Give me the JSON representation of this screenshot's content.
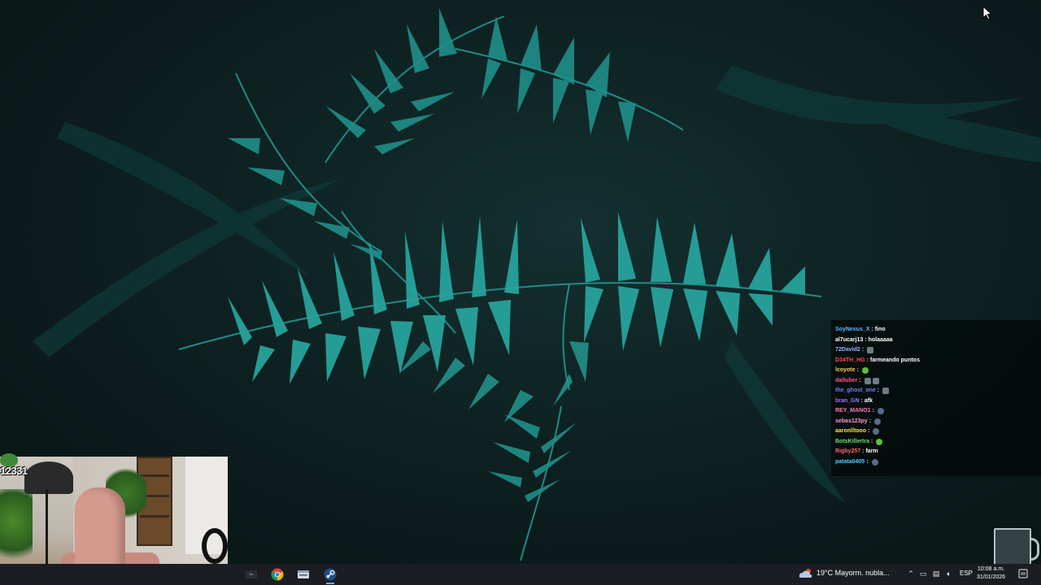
{
  "chat": {
    "messages": [
      {
        "user": "SoyNexus_X",
        "user_color": "#5bb8ff",
        "text": "fino",
        "emotes": []
      },
      {
        "user": "al7ucarj13",
        "user_color": "#ffffff",
        "text": "holaaaaa",
        "emotes": []
      },
      {
        "user": "72David2",
        "user_color": "#9ab4ff",
        "text": "",
        "emotes": [
          "gray"
        ]
      },
      {
        "user": "D34TH_HG",
        "user_color": "#ff4d4d",
        "text": "farmeando puntos",
        "emotes": []
      },
      {
        "user": "lcoyote",
        "user_color": "#ffd34d",
        "text": "",
        "emotes": [
          "green"
        ]
      },
      {
        "user": "dalluber",
        "user_color": "#ff5a8a",
        "text": "",
        "emotes": [
          "gray",
          "gray"
        ]
      },
      {
        "user": "the_ghost_one",
        "user_color": "#7a7aff",
        "text": "",
        "emotes": [
          "gray"
        ]
      },
      {
        "user": "bran_GN",
        "user_color": "#b06bff",
        "text": "afk",
        "emotes": []
      },
      {
        "user": "REY_MANO1",
        "user_color": "#ff7ab6",
        "text": "",
        "emotes": [
          "round"
        ]
      },
      {
        "user": "sebas123py",
        "user_color": "#ff9ad0",
        "text": "",
        "emotes": [
          "round"
        ]
      },
      {
        "user": "aaronlltooo",
        "user_color": "#ffe14d",
        "text": "",
        "emotes": [
          "round"
        ]
      },
      {
        "user": "BotsKillertra",
        "user_color": "#6ee06e",
        "text": "",
        "emotes": [
          "green"
        ]
      },
      {
        "user": "Rigby257",
        "user_color": "#ff6a6a",
        "text": "farm",
        "emotes": []
      },
      {
        "user": "patata0405",
        "user_color": "#4dd2ff",
        "text": "",
        "emotes": [
          "round"
        ]
      }
    ]
  },
  "webcam": {
    "viewer_count": "12331"
  },
  "taskbar": {
    "weather": "19°C  Mayorm. nubla...",
    "language": "ESP",
    "time": "10:08 a.m.",
    "date": "31/01/2026",
    "apps": [
      "stream-deck-icon",
      "chrome-icon",
      "file-manager-icon",
      "steam-icon"
    ]
  },
  "colors": {
    "taskbar_bg": "#1b1d22",
    "fern": "#2aa6a0",
    "wallpaper_dark": "#0b1a1a"
  }
}
